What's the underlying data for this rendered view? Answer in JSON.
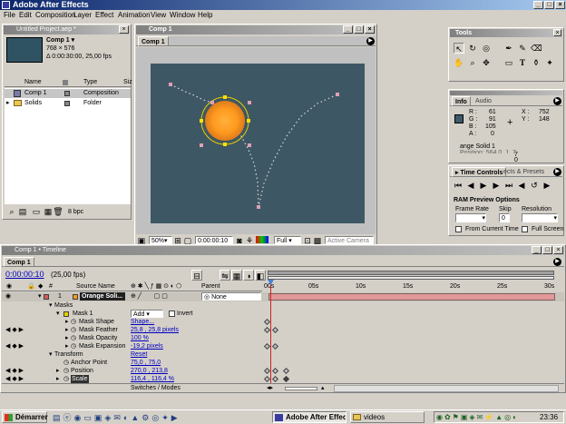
{
  "app": {
    "title": "Adobe After Effects",
    "win_min": "_",
    "win_max": "□",
    "win_close": "×"
  },
  "menu": [
    "File",
    "Edit",
    "Composition",
    "Layer",
    "Effect",
    "Animation",
    "View",
    "Window",
    "Help"
  ],
  "project": {
    "title": "Untitled Project.aep *",
    "comp_name": "Comp 1 ▾",
    "size": "768 × 576",
    "duration": "Δ 0:00:30:00, 25,00 fps",
    "col_name": "Name",
    "col_type": "Type",
    "col_size": "Siz",
    "items": [
      {
        "name": "Comp 1",
        "type": "Composition"
      },
      {
        "name": "Solids",
        "type": "Folder"
      }
    ],
    "bpc": "8 bpc"
  },
  "comp": {
    "title": "Comp 1",
    "tab": "Comp 1",
    "zoom": "50%",
    "timecode": "0:00:00:10",
    "res": "Full",
    "camera": "Active Camera"
  },
  "tools": {
    "title": "Tools"
  },
  "info": {
    "tab_info": "Info",
    "tab_audio": "Audio",
    "r_lbl": "R :",
    "r": "61",
    "g_lbl": "G :",
    "g": "91",
    "b_lbl": "B :",
    "b": "105",
    "a_lbl": "A :",
    "a": "0",
    "x_lbl": "X :",
    "x": "752",
    "y_lbl": "Y :",
    "y": "148",
    "line1": "ange Solid 1",
    "line2": "Position: 564.0, 1..7",
    "line3": "7",
    "line4": "0"
  },
  "time_controls": {
    "tab1": "Time Controls",
    "tab2": "ects & Presets",
    "ram_title": "RAM Preview Options",
    "frame_rate": "Frame Rate",
    "skip": "Skip",
    "skip_val": "0",
    "resolution": "Resolution",
    "from_current": "From Current Time",
    "full_screen": "Full Screen"
  },
  "timeline": {
    "title": "Comp 1 • Timeline",
    "tab": "Comp 1",
    "timecode": "0:00:00:10",
    "fps": "(25,00 fps)",
    "source_name": "Source Name",
    "parent": "Parent",
    "layer_num": "1",
    "layer_name": "Orange Soli...",
    "parent_val": "None",
    "ruler": [
      "00s",
      "05s",
      "10s",
      "15s",
      "20s",
      "25s",
      "30s"
    ],
    "props": [
      {
        "name": "Masks",
        "indent": 1,
        "value": ""
      },
      {
        "name": "Mask 1",
        "indent": 2,
        "value": "Add",
        "extra": "Invert"
      },
      {
        "name": "Mask Shape",
        "indent": 3,
        "value": "Shape..."
      },
      {
        "name": "Mask Feather",
        "indent": 3,
        "value": "25,8 , 25,8 pixels"
      },
      {
        "name": "Mask Opacity",
        "indent": 3,
        "value": "100 %"
      },
      {
        "name": "Mask Expansion",
        "indent": 3,
        "value": "-19,2 pixels"
      },
      {
        "name": "Transform",
        "indent": 1,
        "value": "Reset"
      },
      {
        "name": "Anchor Point",
        "indent": 2,
        "value": "75,0 , 75,0"
      },
      {
        "name": "Position",
        "indent": 2,
        "value": "270,0 , 213,8"
      },
      {
        "name": "Scale",
        "indent": 2,
        "value": "116,4 , 116,4 %"
      }
    ],
    "switches": "Switches / Modes"
  },
  "taskbar": {
    "start": "Démarrer",
    "task1": "Adobe After Effects",
    "task2": "videos",
    "clock": "23:36"
  }
}
